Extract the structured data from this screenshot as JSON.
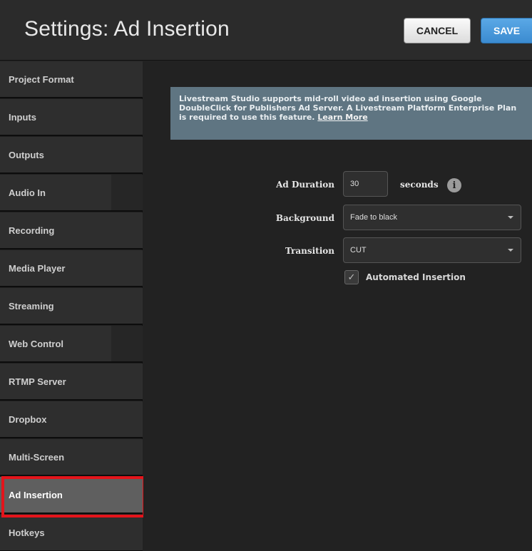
{
  "header": {
    "title": "Settings: Ad Insertion",
    "cancel_label": "CANCEL",
    "save_label": "SAVE"
  },
  "sidebar": {
    "items": [
      {
        "label": "Project Format"
      },
      {
        "label": "Inputs"
      },
      {
        "label": "Outputs"
      },
      {
        "label": "Audio In"
      },
      {
        "label": "Recording"
      },
      {
        "label": "Media Player"
      },
      {
        "label": "Streaming"
      },
      {
        "label": "Web Control"
      },
      {
        "label": "RTMP Server"
      },
      {
        "label": "Dropbox"
      },
      {
        "label": "Multi-Screen"
      },
      {
        "label": "Ad Insertion",
        "active": true
      },
      {
        "label": "Hotkeys"
      }
    ]
  },
  "main": {
    "info_text": "Livestream Studio supports mid-roll video ad insertion using Google DoubleClick for Publishers Ad Server. A Livestream Platform Enterprise Plan is required to use this feature.",
    "info_link": "Learn More",
    "ad_duration_label": "Ad Duration",
    "ad_duration_value": "30",
    "seconds_label": "seconds",
    "info_icon": "info-icon",
    "background_label": "Background",
    "background_value": "Fade to black",
    "transition_label": "Transition",
    "transition_value": "CUT",
    "automated_insertion_label": "Automated Insertion",
    "automated_insertion_checked": true
  },
  "colors": {
    "highlight": "#e3141b",
    "save_button": "#3b8bd0",
    "info_banner": "#5f7582"
  }
}
